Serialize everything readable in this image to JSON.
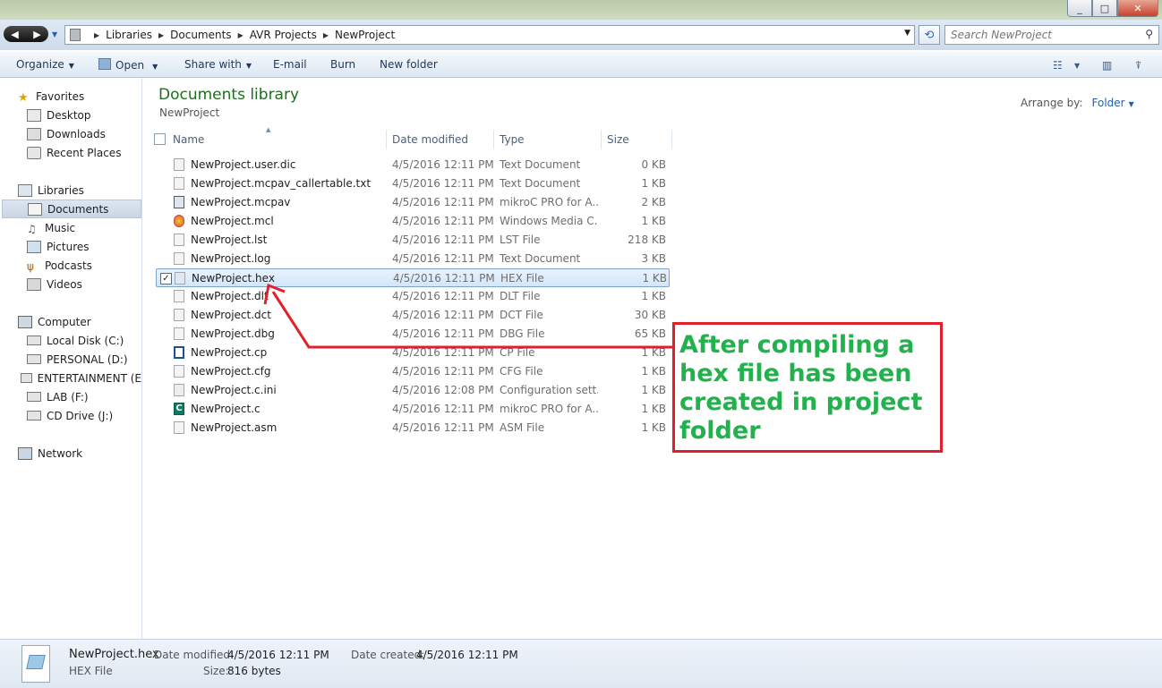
{
  "window": {
    "minimize": "_",
    "maximize": "□",
    "close": "✕"
  },
  "address": {
    "crumbs": [
      "Libraries",
      "Documents",
      "AVR Projects",
      "NewProject"
    ],
    "search_placeholder": "Search NewProject"
  },
  "toolbar": {
    "organize": "Organize",
    "open": "Open",
    "share_with": "Share with",
    "email": "E-mail",
    "burn": "Burn",
    "new_folder": "New folder"
  },
  "sidebar": {
    "favorites": "Favorites",
    "desktop": "Desktop",
    "downloads": "Downloads",
    "recent_places": "Recent Places",
    "libraries": "Libraries",
    "documents": "Documents",
    "music": "Music",
    "pictures": "Pictures",
    "podcasts": "Podcasts",
    "videos": "Videos",
    "computer": "Computer",
    "local_disk": "Local Disk (C:)",
    "personal": "PERSONAL (D:)",
    "entertainment": "ENTERTAINMENT (E",
    "lab": "LAB (F:)",
    "cd_drive": "CD Drive (J:)",
    "network": "Network"
  },
  "library": {
    "title": "Documents library",
    "subtitle": "NewProject",
    "arrange_label": "Arrange by:",
    "arrange_value": "Folder"
  },
  "columns": {
    "name": "Name",
    "date": "Date modified",
    "type": "Type",
    "size": "Size"
  },
  "files": [
    {
      "name": "NewProject.user.dic",
      "date": "4/5/2016 12:11 PM",
      "type": "Text Document",
      "size": "0 KB"
    },
    {
      "name": "NewProject.mcpav_callertable.txt",
      "date": "4/5/2016 12:11 PM",
      "type": "Text Document",
      "size": "1 KB"
    },
    {
      "name": "NewProject.mcpav",
      "date": "4/5/2016 12:11 PM",
      "type": "mikroC PRO for A...",
      "size": "2 KB"
    },
    {
      "name": "NewProject.mcl",
      "date": "4/5/2016 12:11 PM",
      "type": "Windows Media C...",
      "size": "1 KB"
    },
    {
      "name": "NewProject.lst",
      "date": "4/5/2016 12:11 PM",
      "type": "LST File",
      "size": "218 KB"
    },
    {
      "name": "NewProject.log",
      "date": "4/5/2016 12:11 PM",
      "type": "Text Document",
      "size": "3 KB"
    },
    {
      "name": "NewProject.hex",
      "date": "4/5/2016 12:11 PM",
      "type": "HEX File",
      "size": "1 KB"
    },
    {
      "name": "NewProject.dlt",
      "date": "4/5/2016 12:11 PM",
      "type": "DLT File",
      "size": "1 KB"
    },
    {
      "name": "NewProject.dct",
      "date": "4/5/2016 12:11 PM",
      "type": "DCT File",
      "size": "30 KB"
    },
    {
      "name": "NewProject.dbg",
      "date": "4/5/2016 12:11 PM",
      "type": "DBG File",
      "size": "65 KB"
    },
    {
      "name": "NewProject.cp",
      "date": "4/5/2016 12:11 PM",
      "type": "CP File",
      "size": "1 KB"
    },
    {
      "name": "NewProject.cfg",
      "date": "4/5/2016 12:11 PM",
      "type": "CFG File",
      "size": "1 KB"
    },
    {
      "name": "NewProject.c.ini",
      "date": "4/5/2016 12:08 PM",
      "type": "Configuration sett...",
      "size": "1 KB"
    },
    {
      "name": "NewProject.c",
      "date": "4/5/2016 12:11 PM",
      "type": "mikroC PRO for A...",
      "size": "1 KB"
    },
    {
      "name": "NewProject.asm",
      "date": "4/5/2016 12:11 PM",
      "type": "ASM File",
      "size": "1 KB"
    }
  ],
  "annotation": {
    "text": "After compiling a hex file has been created in project folder",
    "color": "#22b14c",
    "border_color": "#e0202a"
  },
  "details": {
    "name": "NewProject.hex",
    "type": "HEX File",
    "date_modified_label": "Date modified:",
    "date_modified": "4/5/2016 12:11 PM",
    "date_created_label": "Date created:",
    "date_created": "4/5/2016 12:11 PM",
    "size_label": "Size:",
    "size": "816 bytes"
  }
}
